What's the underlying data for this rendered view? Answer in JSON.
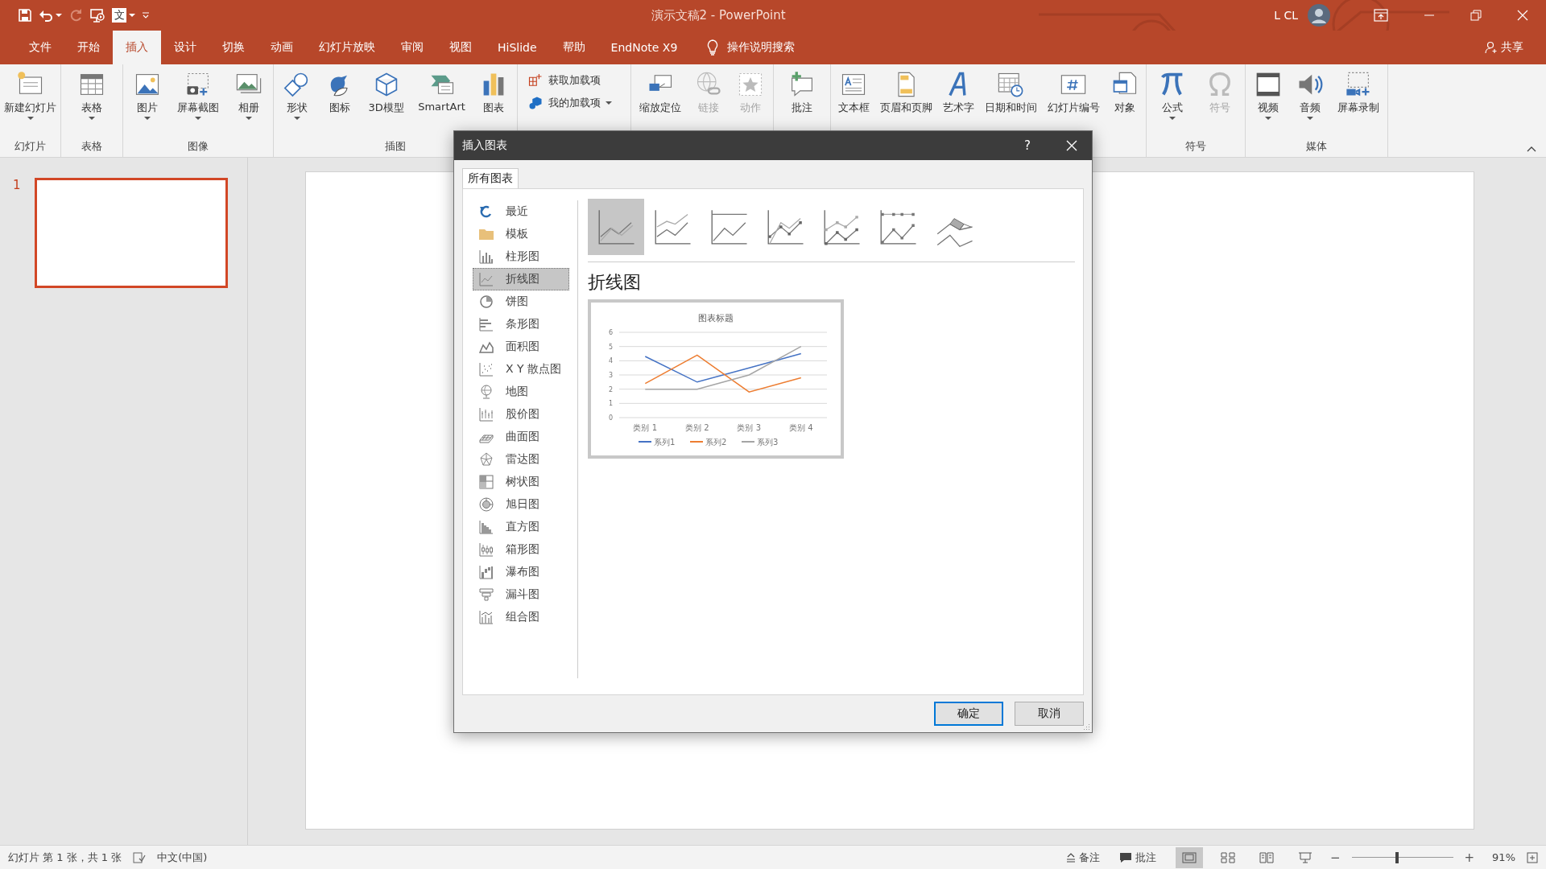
{
  "window": {
    "title": "演示文稿2 - PowerPoint",
    "user": "L CL"
  },
  "quick_access": [
    {
      "disabled": false,
      "dropdown": false
    },
    {
      "disabled": false,
      "dropdown": true
    },
    {
      "disabled": true,
      "dropdown": false
    },
    {
      "disabled": false,
      "dropdown": false
    },
    {
      "disabled": false,
      "dropdown": true,
      "glyph": "文"
    },
    {
      "disabled": false,
      "dropdown": false
    }
  ],
  "tabs": [
    {
      "label": "文件",
      "selected": false
    },
    {
      "label": "开始",
      "selected": false
    },
    {
      "label": "插入",
      "selected": true
    },
    {
      "label": "设计",
      "selected": false
    },
    {
      "label": "切换",
      "selected": false
    },
    {
      "label": "动画",
      "selected": false
    },
    {
      "label": "幻灯片放映",
      "selected": false
    },
    {
      "label": "审阅",
      "selected": false
    },
    {
      "label": "视图",
      "selected": false
    },
    {
      "label": "HiSlide",
      "selected": false
    },
    {
      "label": "帮助",
      "selected": false
    },
    {
      "label": "EndNote X9",
      "selected": false
    }
  ],
  "tell_me": {
    "label": "操作说明搜索"
  },
  "share": {
    "label": "共享"
  },
  "ribbon": {
    "groups": [
      {
        "label": "幻灯片",
        "items": [
          {
            "label": "新建幻灯片",
            "kind": "large",
            "dropdown": true,
            "disabled": false
          }
        ]
      },
      {
        "label": "表格",
        "items": [
          {
            "label": "表格",
            "kind": "large",
            "dropdown": true,
            "disabled": false
          }
        ]
      },
      {
        "label": "图像",
        "items": [
          {
            "label": "图片",
            "kind": "large",
            "dropdown": true,
            "disabled": false
          },
          {
            "label": "屏幕截图",
            "kind": "large",
            "dropdown": true,
            "disabled": false
          },
          {
            "label": "相册",
            "kind": "large",
            "dropdown": true,
            "disabled": false
          }
        ]
      },
      {
        "label": "插图",
        "items": [
          {
            "label": "形状",
            "kind": "large",
            "dropdown": true,
            "disabled": false
          },
          {
            "label": "图标",
            "kind": "large",
            "dropdown": false,
            "disabled": false
          },
          {
            "label": "3D模型",
            "kind": "large",
            "dropdown": false,
            "disabled": false
          },
          {
            "label": "SmartArt",
            "kind": "large",
            "dropdown": false,
            "disabled": false
          },
          {
            "label": "图表",
            "kind": "large",
            "dropdown": false,
            "disabled": false
          }
        ]
      },
      {
        "items": [
          {
            "label": "获取加载项",
            "kind": "small",
            "dropdown": false,
            "disabled": false
          },
          {
            "label": "我的加载项",
            "kind": "small",
            "dropdown": true,
            "disabled": false
          }
        ]
      },
      {
        "items": [
          {
            "label": "缩放定位",
            "kind": "large",
            "dropdown": false,
            "disabled": false
          },
          {
            "label": "链接",
            "kind": "large",
            "dropdown": false,
            "disabled": true
          },
          {
            "label": "动作",
            "kind": "large",
            "dropdown": false,
            "disabled": true
          }
        ]
      },
      {
        "items": [
          {
            "label": "批注",
            "kind": "large",
            "dropdown": false,
            "disabled": false
          }
        ]
      },
      {
        "items": [
          {
            "label": "文本框",
            "kind": "large",
            "dropdown": false,
            "disabled": false
          },
          {
            "label": "页眉和页脚",
            "kind": "large",
            "dropdown": false,
            "disabled": false
          },
          {
            "label": "艺术字",
            "kind": "large",
            "dropdown": false,
            "disabled": false
          },
          {
            "label": "日期和时间",
            "kind": "large",
            "dropdown": false,
            "disabled": false
          },
          {
            "label": "幻灯片编号",
            "kind": "large",
            "dropdown": false,
            "disabled": false
          },
          {
            "label": "对象",
            "kind": "large",
            "dropdown": false,
            "disabled": false
          }
        ]
      },
      {
        "label": "符号",
        "items": [
          {
            "label": "公式",
            "kind": "large",
            "dropdown": true,
            "disabled": false
          },
          {
            "label": "符号",
            "kind": "large",
            "dropdown": false,
            "disabled": true
          }
        ]
      },
      {
        "label": "媒体",
        "items": [
          {
            "label": "视频",
            "kind": "large",
            "dropdown": true,
            "disabled": false
          },
          {
            "label": "音频",
            "kind": "large",
            "dropdown": true,
            "disabled": false
          },
          {
            "label": "屏幕录制",
            "kind": "large",
            "dropdown": false,
            "disabled": false
          }
        ]
      }
    ]
  },
  "slides": [
    {
      "number": "1",
      "selected": true
    }
  ],
  "dialog": {
    "title": "插入图表",
    "help": "?",
    "tabs": [
      {
        "label": "所有图表",
        "selected": true
      }
    ],
    "chart_types": [
      {
        "label": "最近",
        "selected": false
      },
      {
        "label": "模板",
        "selected": false
      },
      {
        "label": "柱形图",
        "selected": false
      },
      {
        "label": "折线图",
        "selected": true
      },
      {
        "label": "饼图",
        "selected": false
      },
      {
        "label": "条形图",
        "selected": false
      },
      {
        "label": "面积图",
        "selected": false
      },
      {
        "label": "X Y 散点图",
        "selected": false
      },
      {
        "label": "地图",
        "selected": false
      },
      {
        "label": "股价图",
        "selected": false
      },
      {
        "label": "曲面图",
        "selected": false
      },
      {
        "label": "雷达图",
        "selected": false
      },
      {
        "label": "树状图",
        "selected": false
      },
      {
        "label": "旭日图",
        "selected": false
      },
      {
        "label": "直方图",
        "selected": false
      },
      {
        "label": "箱形图",
        "selected": false
      },
      {
        "label": "瀑布图",
        "selected": false
      },
      {
        "label": "漏斗图",
        "selected": false
      },
      {
        "label": "组合图",
        "selected": false
      }
    ],
    "subtypes": [
      {
        "selected": true
      },
      {
        "selected": false
      },
      {
        "selected": false
      },
      {
        "selected": false
      },
      {
        "selected": false
      },
      {
        "selected": false
      },
      {
        "selected": false
      }
    ],
    "heading": "折线图",
    "preview": {
      "chart_data": {
        "type": "line",
        "title": "图表标题",
        "categories": [
          "类别 1",
          "类别 2",
          "类别 3",
          "类别 4"
        ],
        "series": [
          {
            "name": "系列1",
            "color": "#4472c4",
            "values": [
              4.3,
              2.5,
              3.5,
              4.5
            ]
          },
          {
            "name": "系列2",
            "color": "#ed7d31",
            "values": [
              2.4,
              4.4,
              1.8,
              2.8
            ]
          },
          {
            "name": "系列3",
            "color": "#a5a5a5",
            "values": [
              2,
              2,
              3,
              5
            ]
          }
        ],
        "ylim": [
          0,
          6
        ],
        "yticks": [
          0,
          1,
          2,
          3,
          4,
          5,
          6
        ],
        "grid": true,
        "legend": "bottom"
      }
    },
    "buttons": [
      {
        "label": "确定",
        "default": true
      },
      {
        "label": "取消",
        "default": false
      }
    ]
  },
  "status_bar": {
    "slide_info": "幻灯片 第 1 张，共 1 张",
    "language": "中文(中国)",
    "notes": "备注",
    "comments": "批注",
    "views": [
      {
        "selected": true
      },
      {
        "selected": false
      },
      {
        "selected": false
      },
      {
        "selected": false
      }
    ],
    "zoom": {
      "zoom_out": "−",
      "zoom_in": "+",
      "level": 0.45,
      "reading": "91%"
    }
  }
}
